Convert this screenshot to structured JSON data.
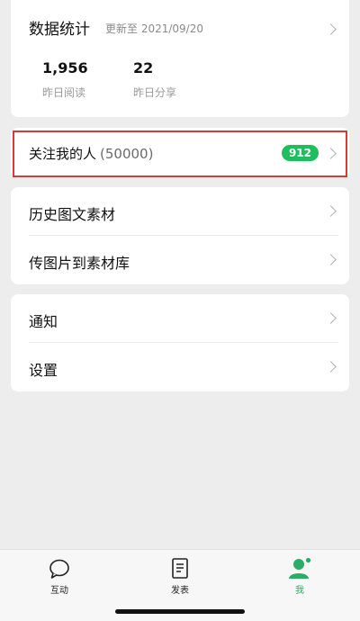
{
  "stats": {
    "title": "数据统计",
    "updated": "更新至 2021/09/20",
    "items": [
      {
        "value": "1,956",
        "label": "昨日阅读"
      },
      {
        "value": "22",
        "label": "昨日分享"
      }
    ]
  },
  "followers": {
    "label": "关注我的人",
    "count": "(50000)",
    "badge": "912",
    "highlight_color": "#d93a34",
    "badge_color": "#1fbe5c"
  },
  "materials": {
    "items": [
      {
        "label": "历史图文素材"
      },
      {
        "label": "传图片到素材库"
      }
    ]
  },
  "settings": {
    "items": [
      {
        "label": "通知"
      },
      {
        "label": "设置"
      }
    ]
  },
  "tabbar": {
    "tabs": [
      {
        "label": "互动",
        "icon": "chat-bubble-icon"
      },
      {
        "label": "发表",
        "icon": "document-icon"
      },
      {
        "label": "我",
        "icon": "person-icon",
        "active": true
      }
    ],
    "active_color": "#2aae67"
  }
}
